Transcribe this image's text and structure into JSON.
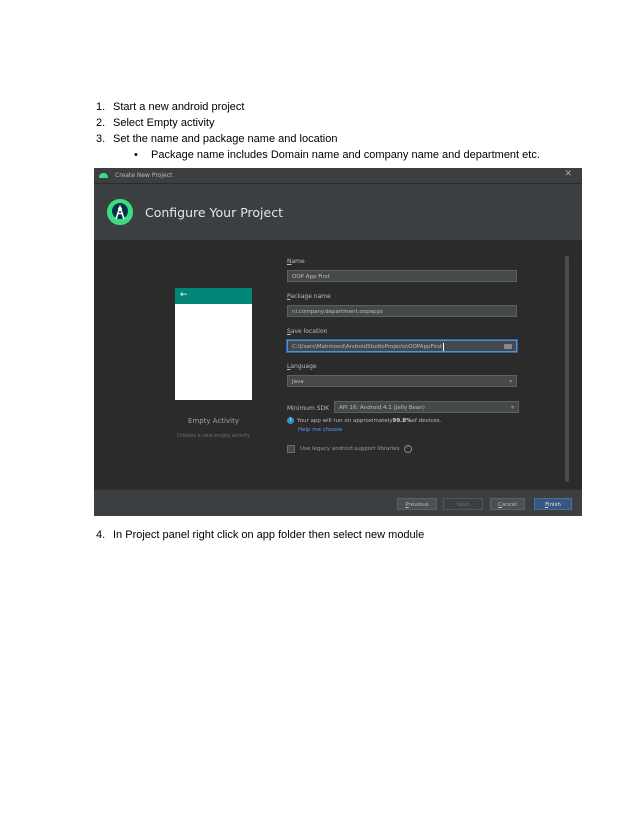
{
  "doc": {
    "steps": [
      {
        "num": "1.",
        "text": "Start a new android project"
      },
      {
        "num": "2.",
        "text": "Select Empty activity"
      },
      {
        "num": "3.",
        "text": "Set the name and package name and location"
      }
    ],
    "bullet": {
      "dot": "•",
      "text": "Package name includes Domain name and company name and department etc."
    },
    "step4": {
      "num": "4.",
      "text": "In Project panel right click on app folder then select new module"
    }
  },
  "dialog": {
    "window_title": "Create New Project",
    "close_glyph": "✕",
    "heading": "Configure Your Project",
    "template": {
      "back_arrow": "←",
      "name": "Empty Activity",
      "description": "Creates a new empty activity"
    },
    "form": {
      "name_label_key": "N",
      "name_label_rest": "ame",
      "name_value": "OOP App First",
      "package_label_key": "P",
      "package_label_rest": "ackage name",
      "package_value": "nl.company.department.oopapps",
      "location_label_key": "S",
      "location_label_rest": "ave location",
      "location_value": "C:\\Users\\Mahmood\\AndroidStudioProjects\\OOPAppFirst",
      "language_label_key": "L",
      "language_label_rest": "anguage",
      "language_value": "Java",
      "dropdown_glyph": "▾",
      "sdk_label": "Minimum SDK",
      "sdk_value": "API 16: Android 4.1 (Jelly Bean)",
      "info_glyph": "i",
      "info_prefix": "Your app will run on approximately ",
      "info_bold": "99.8%",
      "info_suffix": " of devices.",
      "help_link": "Help me choose",
      "legacy_label": "Use legacy android.support libraries",
      "q_glyph": "?"
    },
    "buttons": {
      "previous_key": "P",
      "previous_rest": "revious",
      "next": "Next",
      "cancel_key": "C",
      "cancel_rest": "ancel",
      "finish_key": "F",
      "finish_rest": "inish"
    }
  }
}
